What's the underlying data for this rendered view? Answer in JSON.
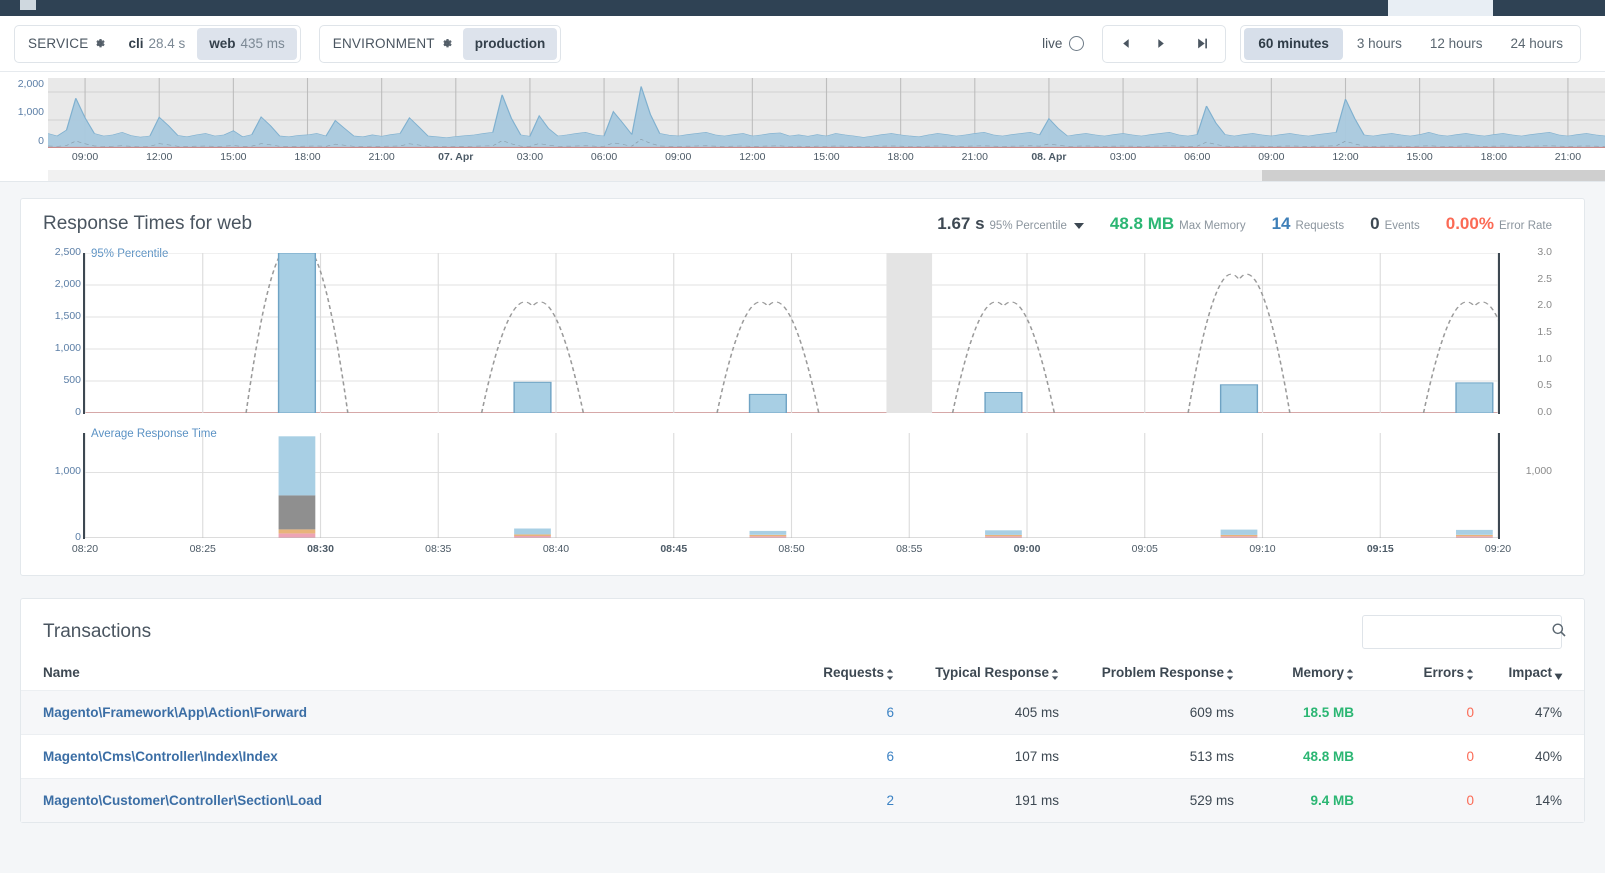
{
  "topbar": {
    "logo": "app-logo"
  },
  "controls": {
    "service": {
      "label": "SERVICE",
      "gear": "gear-icon",
      "items": [
        {
          "name": "cli",
          "value": "28.4 s",
          "selected": false
        },
        {
          "name": "web",
          "value": "435 ms",
          "selected": true
        }
      ]
    },
    "environment": {
      "label": "ENVIRONMENT",
      "gear": "gear-icon",
      "items": [
        {
          "name": "production",
          "selected": true
        }
      ]
    },
    "live": {
      "label": "live",
      "icon": "live-ring-icon"
    },
    "nav": {
      "prev": "prev-arrow-icon",
      "next": "next-arrow-icon",
      "latest": "skip-to-latest-icon"
    },
    "ranges": [
      {
        "label": "60 minutes",
        "selected": true
      },
      {
        "label": "3 hours",
        "selected": false
      },
      {
        "label": "12 hours",
        "selected": false
      },
      {
        "label": "24 hours",
        "selected": false
      }
    ]
  },
  "overview_chart": {
    "type": "area",
    "title": "",
    "ylabel": "",
    "xlabel": "",
    "ylim": [
      0,
      2500
    ],
    "yticks": [
      0,
      1000,
      2000
    ],
    "yticklabels": [
      "0",
      "1,000",
      "2,000"
    ],
    "xticklabels": [
      {
        "label": "09:00",
        "bold": false
      },
      {
        "label": "12:00",
        "bold": false
      },
      {
        "label": "15:00",
        "bold": false
      },
      {
        "label": "18:00",
        "bold": false
      },
      {
        "label": "21:00",
        "bold": false
      },
      {
        "label": "07. Apr",
        "bold": true
      },
      {
        "label": "03:00",
        "bold": false
      },
      {
        "label": "06:00",
        "bold": false
      },
      {
        "label": "09:00",
        "bold": false
      },
      {
        "label": "12:00",
        "bold": false
      },
      {
        "label": "15:00",
        "bold": false
      },
      {
        "label": "18:00",
        "bold": false
      },
      {
        "label": "21:00",
        "bold": false
      },
      {
        "label": "08. Apr",
        "bold": true
      },
      {
        "label": "03:00",
        "bold": false
      },
      {
        "label": "06:00",
        "bold": false
      },
      {
        "label": "09:00",
        "bold": false
      },
      {
        "label": "12:00",
        "bold": false
      },
      {
        "label": "15:00",
        "bold": false
      },
      {
        "label": "18:00",
        "bold": false
      },
      {
        "label": "21:00",
        "bold": false
      }
    ],
    "series": [
      {
        "name": "response time area",
        "color": "#a9c9de",
        "values": [
          520,
          430,
          640,
          1780,
          1080,
          520,
          430,
          470,
          560,
          440,
          390,
          430,
          1100,
          800,
          450,
          400,
          470,
          520,
          430,
          470,
          620,
          400,
          480,
          1110,
          800,
          430,
          400,
          450,
          470,
          520,
          430,
          980,
          700,
          430,
          400,
          470,
          420,
          480,
          520,
          1080,
          760,
          430,
          400,
          370,
          410,
          440,
          470,
          520,
          560,
          1900,
          1060,
          470,
          420,
          1150,
          700,
          430,
          470,
          520,
          560,
          470,
          430,
          1300,
          900,
          480,
          2200,
          1200,
          520,
          460,
          430,
          480,
          520,
          560,
          470,
          430,
          480,
          520,
          430,
          470,
          520,
          540,
          430,
          470,
          420,
          480,
          430,
          520,
          470,
          430,
          380,
          430,
          480,
          520,
          470,
          430,
          400,
          470,
          520,
          480,
          430,
          470,
          520,
          560,
          470,
          430,
          480,
          520,
          560,
          470,
          1050,
          700,
          430,
          480,
          520,
          470,
          430,
          480,
          520,
          470,
          430,
          480,
          520,
          560,
          470,
          430,
          480,
          1500,
          900,
          480,
          430,
          480,
          520,
          470,
          430,
          480,
          520,
          470,
          430,
          480,
          520,
          560,
          1750,
          1050,
          470,
          430,
          480,
          520,
          470,
          430,
          480,
          560,
          470,
          430,
          480,
          520,
          470,
          430,
          480,
          520,
          470,
          430,
          480,
          520,
          560,
          470,
          430,
          480,
          520,
          470,
          430
        ]
      },
      {
        "name": "error baseline",
        "color": "#c98b8b",
        "values": [
          0,
          0,
          0,
          0,
          0,
          0,
          0,
          0,
          0,
          0,
          0,
          0,
          0,
          0,
          0,
          0,
          0,
          0,
          0,
          0,
          0,
          0,
          0,
          0,
          0,
          0,
          0,
          0,
          0,
          0,
          0,
          0,
          0,
          0,
          0,
          0,
          0,
          0,
          0,
          0
        ]
      }
    ]
  },
  "response_card": {
    "title": "Response Times for web",
    "metrics": [
      {
        "name": "percentile",
        "value": "1.67 s",
        "unit": "95% Percentile",
        "color": "#3d4852",
        "dropdown": true
      },
      {
        "name": "max-memory",
        "value": "48.8 MB",
        "unit": "Max Memory",
        "color": "#2bb673",
        "dropdown": false
      },
      {
        "name": "requests",
        "value": "14",
        "unit": "Requests",
        "color": "#3e7fb8",
        "dropdown": false
      },
      {
        "name": "events",
        "value": "0",
        "unit": "Events",
        "color": "#3d4852",
        "dropdown": false
      },
      {
        "name": "error-rate",
        "value": "0.00%",
        "unit": "Error Rate",
        "color": "#fb6a55",
        "dropdown": false
      }
    ]
  },
  "percentile_chart": {
    "type": "bar",
    "title": "95% Percentile",
    "ylabel": "95% Percentile",
    "xlabel": "",
    "ylim": [
      0,
      2500
    ],
    "yticks": [
      0,
      500,
      1000,
      1500,
      2000,
      2500
    ],
    "yticklabels": [
      "0",
      "500",
      "1,000",
      "1,500",
      "2,000",
      "2,500"
    ],
    "y2lim": [
      0,
      3.0
    ],
    "y2ticks": [
      0.0,
      0.5,
      1.0,
      1.5,
      2.0,
      2.5,
      3.0
    ],
    "y2ticklabels": [
      "0.0",
      "0.5",
      "1.0",
      "1.5",
      "2.0",
      "2.5",
      "3.0"
    ],
    "grid": true,
    "highlight_band": {
      "x_label": "08:55",
      "color": "#e4e4e4"
    },
    "bars": [
      {
        "x": "08:29",
        "value": 2500
      },
      {
        "x": "08:39",
        "value": 480
      },
      {
        "x": "08:49",
        "value": 290
      },
      {
        "x": "08:59",
        "value": 320
      },
      {
        "x": "09:09",
        "value": 440
      },
      {
        "x": "09:19",
        "value": 470
      }
    ],
    "requests_line": {
      "name": "Requests",
      "style": "dashed",
      "color": "#9a9a9a",
      "peaks": [
        {
          "x": "08:29",
          "value": 3.0
        },
        {
          "x": "08:39",
          "value": 2.0
        },
        {
          "x": "08:49",
          "value": 2.0
        },
        {
          "x": "08:59",
          "value": 2.0
        },
        {
          "x": "09:09",
          "value": 2.5
        },
        {
          "x": "09:19",
          "value": 2.0
        }
      ]
    },
    "baseline_color": "#c98b8b"
  },
  "avg_chart": {
    "type": "bar",
    "title": "Average Response Time",
    "ylabel": "Average Response Time",
    "ylim": [
      0,
      1600
    ],
    "yticks": [
      0,
      1000
    ],
    "yticklabels": [
      "0",
      "1,000"
    ],
    "y2ticks": [
      1000
    ],
    "y2ticklabels": [
      "1,000"
    ],
    "stack_order": [
      "other",
      "sql",
      "view",
      "app"
    ],
    "stack_colors": {
      "app": "#a8cfe4",
      "view": "#8f8f8f",
      "sql": "#e8b37a",
      "other": "#eda3b4"
    },
    "bars": [
      {
        "x": "08:29",
        "app": 900,
        "view": 520,
        "sql": 60,
        "other": 70
      },
      {
        "x": "08:39",
        "app": 90,
        "view": 0,
        "sql": 25,
        "other": 30
      },
      {
        "x": "08:49",
        "app": 60,
        "view": 0,
        "sql": 22,
        "other": 26
      },
      {
        "x": "08:59",
        "app": 70,
        "view": 0,
        "sql": 22,
        "other": 26
      },
      {
        "x": "09:09",
        "app": 80,
        "view": 0,
        "sql": 22,
        "other": 26
      },
      {
        "x": "09:19",
        "app": 75,
        "view": 0,
        "sql": 22,
        "other": 26
      }
    ],
    "xticklabels": [
      {
        "label": "08:20",
        "bold": false
      },
      {
        "label": "08:25",
        "bold": false
      },
      {
        "label": "08:30",
        "bold": true
      },
      {
        "label": "08:35",
        "bold": false
      },
      {
        "label": "08:40",
        "bold": false
      },
      {
        "label": "08:45",
        "bold": true
      },
      {
        "label": "08:50",
        "bold": false
      },
      {
        "label": "08:55",
        "bold": false
      },
      {
        "label": "09:00",
        "bold": true
      },
      {
        "label": "09:05",
        "bold": false
      },
      {
        "label": "09:10",
        "bold": false
      },
      {
        "label": "09:15",
        "bold": true
      },
      {
        "label": "09:20",
        "bold": false
      }
    ]
  },
  "transactions": {
    "title": "Transactions",
    "search": {
      "placeholder": "",
      "value": "",
      "icon": "search-icon"
    },
    "columns": [
      {
        "key": "name",
        "label": "Name",
        "sortable": false
      },
      {
        "key": "requests",
        "label": "Requests",
        "sortable": true
      },
      {
        "key": "typical",
        "label": "Typical Response",
        "sortable": true
      },
      {
        "key": "problem",
        "label": "Problem Response",
        "sortable": true
      },
      {
        "key": "memory",
        "label": "Memory",
        "sortable": true
      },
      {
        "key": "errors",
        "label": "Errors",
        "sortable": true
      },
      {
        "key": "impact",
        "label": "Impact",
        "sortable": true,
        "active_sort": "desc"
      }
    ],
    "rows": [
      {
        "name": "Magento\\Framework\\App\\Action\\Forward",
        "requests": "6",
        "typical": "405 ms",
        "problem": "609 ms",
        "memory": "18.5 MB",
        "errors": "0",
        "impact": "47%"
      },
      {
        "name": "Magento\\Cms\\Controller\\Index\\Index",
        "requests": "6",
        "typical": "107 ms",
        "problem": "513 ms",
        "memory": "48.8 MB",
        "errors": "0",
        "impact": "40%"
      },
      {
        "name": "Magento\\Customer\\Controller\\Section\\Load",
        "requests": "2",
        "typical": "191 ms",
        "problem": "529 ms",
        "memory": "9.4 MB",
        "errors": "0",
        "impact": "14%"
      }
    ]
  }
}
